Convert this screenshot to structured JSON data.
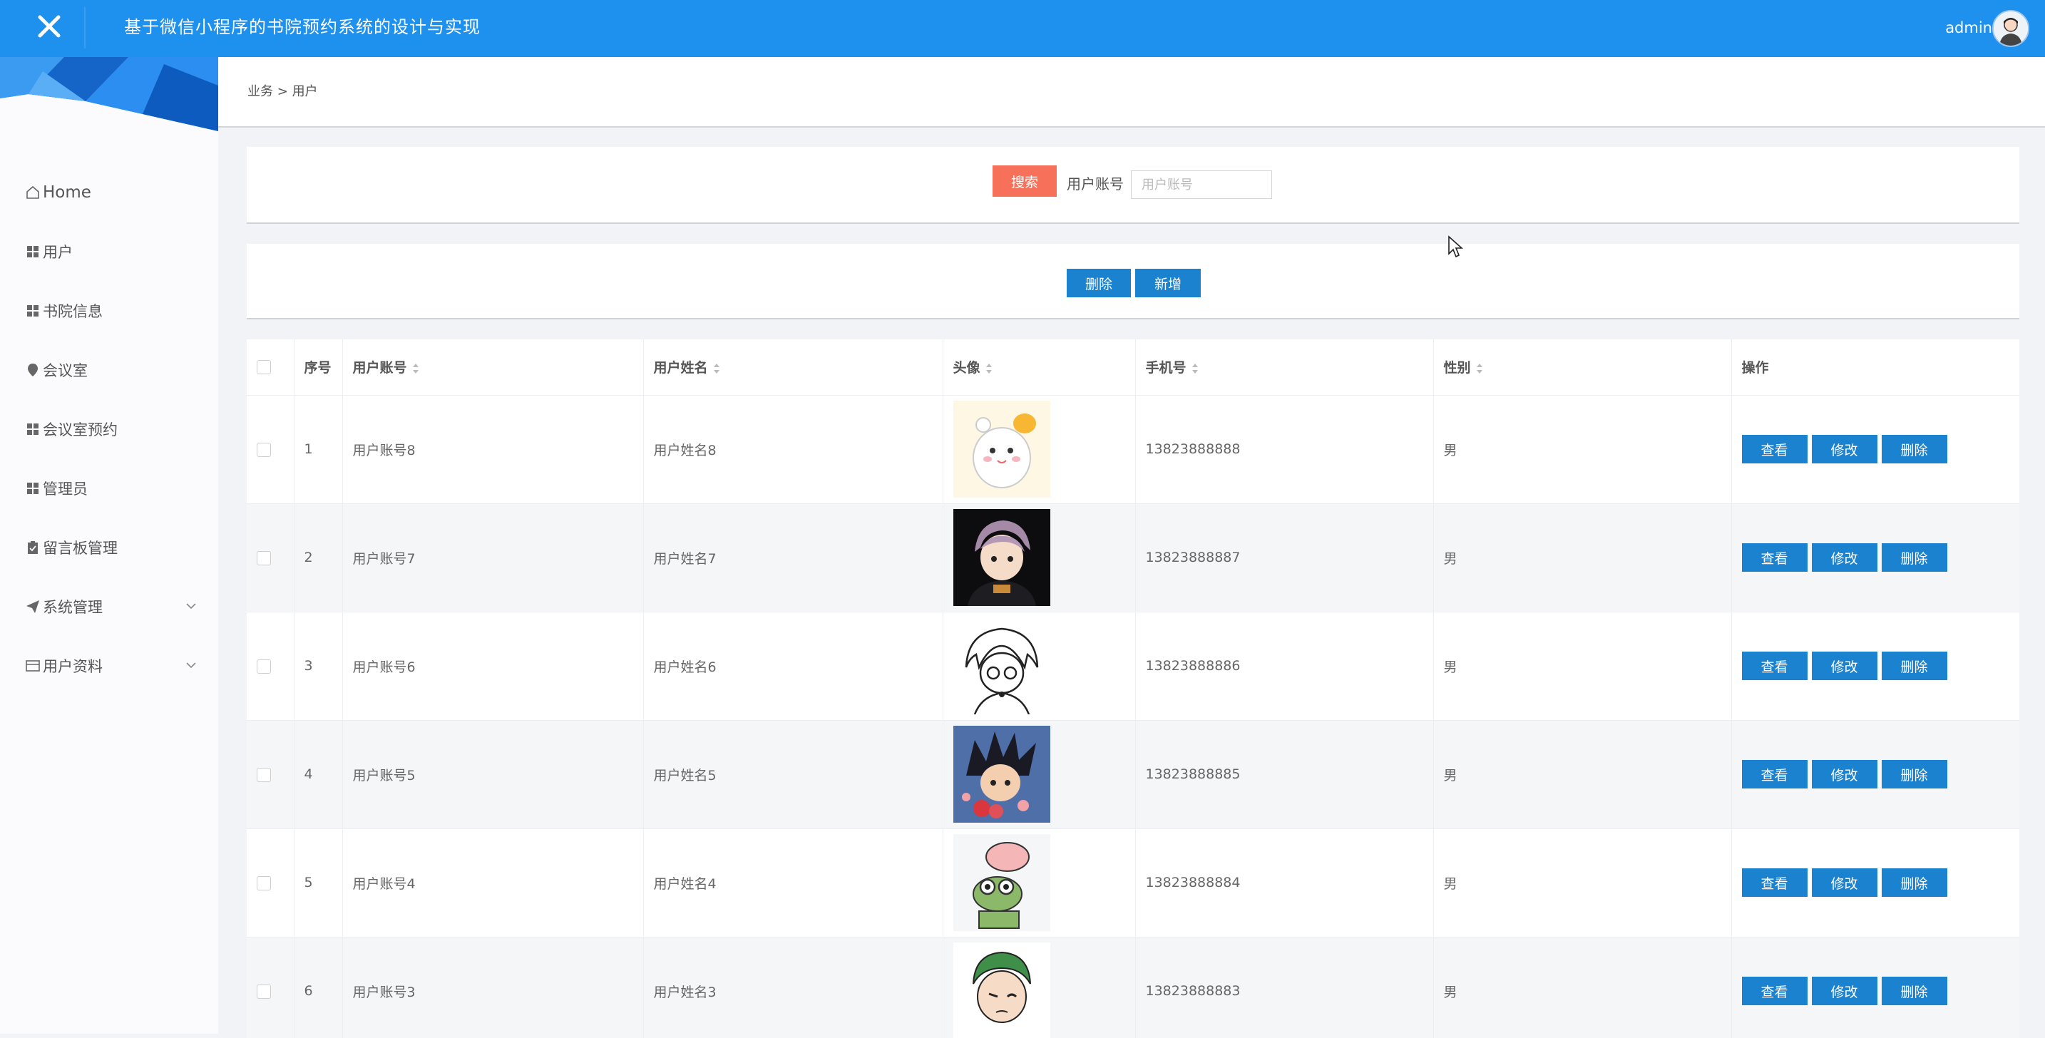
{
  "header": {
    "title": "基于微信小程序的书院预约系统的设计与实现",
    "user": "admin"
  },
  "sidebar": {
    "items": [
      {
        "label": "Home",
        "icon": "home-icon"
      },
      {
        "label": "用户",
        "icon": "grid-icon"
      },
      {
        "label": "书院信息",
        "icon": "grid-icon"
      },
      {
        "label": "会议室",
        "icon": "pin-icon"
      },
      {
        "label": "会议室预约",
        "icon": "grid-icon"
      },
      {
        "label": "管理员",
        "icon": "grid-icon"
      },
      {
        "label": "留言板管理",
        "icon": "clipboard-icon"
      },
      {
        "label": "系统管理",
        "icon": "send-icon",
        "expandable": true
      },
      {
        "label": "用户资料",
        "icon": "card-icon",
        "expandable": true
      }
    ]
  },
  "breadcrumb": {
    "parent": "业务",
    "separator": ">",
    "current": "用户"
  },
  "search": {
    "button": "搜索",
    "label": "用户账号",
    "placeholder": "用户账号",
    "value": ""
  },
  "actions": {
    "delete": "删除",
    "add": "新增"
  },
  "table": {
    "columns": [
      "序号",
      "用户账号",
      "用户姓名",
      "头像",
      "手机号",
      "性别",
      "操作"
    ],
    "row_actions": {
      "view": "查看",
      "edit": "修改",
      "delete": "删除"
    },
    "rows": [
      {
        "index": "1",
        "account": "用户账号8",
        "name": "用户姓名8",
        "avatar": "hamster-avatar",
        "phone": "13823888888",
        "gender": "男"
      },
      {
        "index": "2",
        "account": "用户账号7",
        "name": "用户姓名7",
        "avatar": "anime-boy-dark-avatar",
        "phone": "13823888887",
        "gender": "男"
      },
      {
        "index": "3",
        "account": "用户账号6",
        "name": "用户姓名6",
        "avatar": "sketch-girl-avatar",
        "phone": "13823888886",
        "gender": "男"
      },
      {
        "index": "4",
        "account": "用户账号5",
        "name": "用户姓名5",
        "avatar": "goku-avatar",
        "phone": "13823888885",
        "gender": "男"
      },
      {
        "index": "5",
        "account": "用户账号4",
        "name": "用户姓名4",
        "avatar": "frog-pig-avatar",
        "phone": "13823888884",
        "gender": "男"
      },
      {
        "index": "6",
        "account": "用户账号3",
        "name": "用户姓名3",
        "avatar": "green-hair-avatar",
        "phone": "13823888883",
        "gender": "男"
      }
    ]
  },
  "colors": {
    "header": "#1e90ee",
    "search_button": "#f7705a",
    "primary_button": "#1a82cf"
  }
}
